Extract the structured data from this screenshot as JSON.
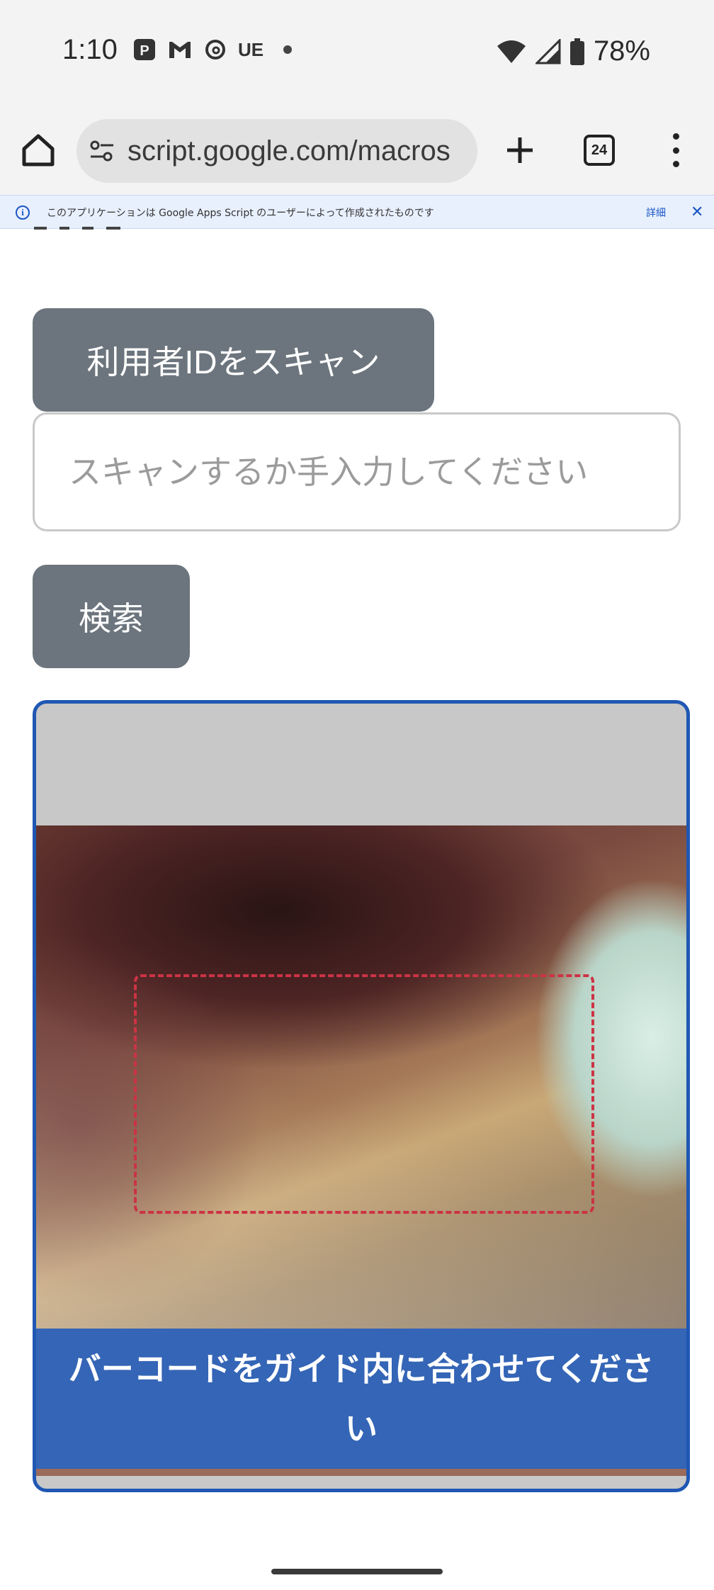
{
  "status_bar": {
    "time": "1:10",
    "left_icons": [
      "paypay-icon",
      "gmail-icon",
      "threads-icon",
      "ue-icon",
      "dot-icon"
    ],
    "ue_label": "UE",
    "battery_percent": "78%",
    "right_icons": [
      "wifi-icon",
      "signal-icon",
      "battery-icon"
    ]
  },
  "browser": {
    "url": "script.google.com/macros",
    "tab_count": "24"
  },
  "banner": {
    "text": "このアプリケーションは Google Apps Script のユーザーによって作成されたものです",
    "link": "詳細",
    "close": "✕"
  },
  "form": {
    "scan_button_label": "利用者IDをスキャン",
    "id_input_placeholder": "スキャンするか手入力してください",
    "id_input_value": "",
    "search_button_label": "検索"
  },
  "scanner": {
    "caption": "バーコードをガイド内に合わせてください"
  },
  "colors": {
    "button_bg": "#6c757d",
    "scanner_border": "#1f57b3",
    "guide_dash": "#cc3344",
    "banner_bg": "#e8f0fe"
  }
}
